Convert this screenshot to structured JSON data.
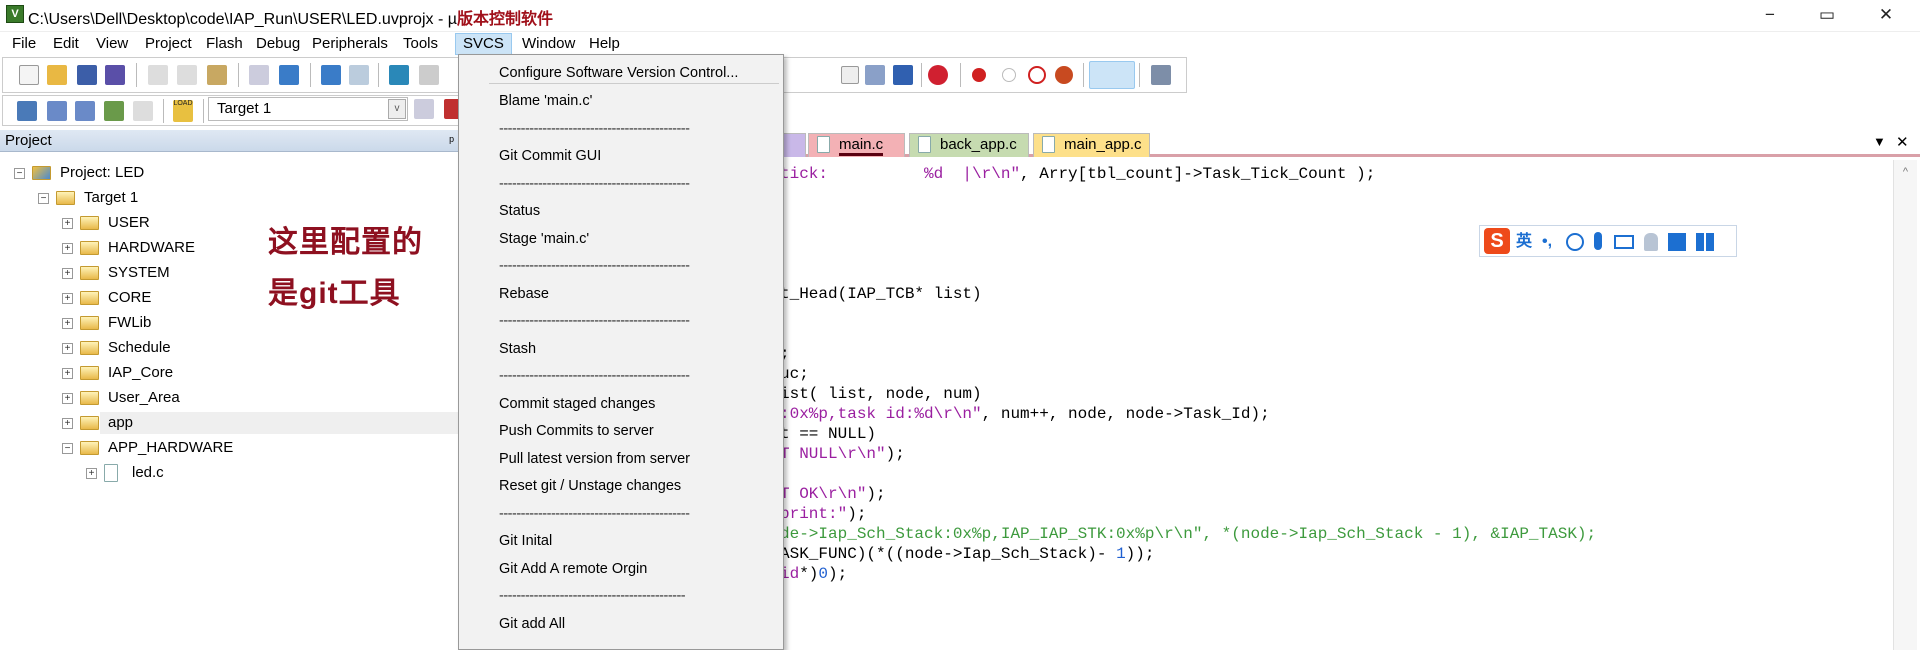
{
  "window": {
    "title": "C:\\Users\\Dell\\Desktop\\code\\IAP_Run\\USER\\LED.uvprojx - µ",
    "title_annotation": "版本控制软件",
    "controls": {
      "minimize": "−",
      "maximize": "▭",
      "close": "✕"
    }
  },
  "menubar": [
    "File",
    "Edit",
    "View",
    "Project",
    "Flash",
    "Debug",
    "Peripherals",
    "Tools",
    "SVCS",
    "Window",
    "Help"
  ],
  "toolbar": {
    "target": "Target 1",
    "load_label": "LOAD"
  },
  "project_panel": {
    "title": "Project",
    "pin": "ᵖ",
    "tree": [
      {
        "label": "Project: LED",
        "level": 0,
        "expanded": true,
        "kind": "project"
      },
      {
        "label": "Target 1",
        "level": 1,
        "expanded": true,
        "kind": "target"
      },
      {
        "label": "USER",
        "level": 2,
        "expanded": false,
        "kind": "folder"
      },
      {
        "label": "HARDWARE",
        "level": 2,
        "expanded": false,
        "kind": "folder"
      },
      {
        "label": "SYSTEM",
        "level": 2,
        "expanded": false,
        "kind": "folder"
      },
      {
        "label": "CORE",
        "level": 2,
        "expanded": false,
        "kind": "folder"
      },
      {
        "label": "FWLib",
        "level": 2,
        "expanded": false,
        "kind": "folder"
      },
      {
        "label": "Schedule",
        "level": 2,
        "expanded": false,
        "kind": "folder"
      },
      {
        "label": "IAP_Core",
        "level": 2,
        "expanded": false,
        "kind": "folder"
      },
      {
        "label": "User_Area",
        "level": 2,
        "expanded": false,
        "kind": "folder"
      },
      {
        "label": "app",
        "level": 2,
        "expanded": false,
        "kind": "folder",
        "selected": true
      },
      {
        "label": "APP_HARDWARE",
        "level": 2,
        "expanded": true,
        "kind": "folder"
      },
      {
        "label": "led.c",
        "level": 3,
        "expanded": false,
        "kind": "file"
      }
    ],
    "annotation": [
      "这里配置的",
      "是git工具"
    ]
  },
  "svcs_menu": [
    {
      "label": "Configure Software Version Control..."
    },
    {
      "separator": true
    },
    {
      "label": "Blame 'main.c'"
    },
    {
      "label": "--------------------------------------------",
      "dash": true
    },
    {
      "label": "Git Commit GUI"
    },
    {
      "label": "--------------------------------------------",
      "dash": true
    },
    {
      "label": "Status"
    },
    {
      "label": "Stage 'main.c'"
    },
    {
      "label": "--------------------------------------------",
      "dash": true
    },
    {
      "label": "Rebase"
    },
    {
      "label": "--------------------------------------------",
      "dash": true
    },
    {
      "label": "Stash"
    },
    {
      "label": "--------------------------------------------",
      "dash": true
    },
    {
      "label": "Commit staged changes"
    },
    {
      "label": "Push Commits to server"
    },
    {
      "label": "Pull latest version from server"
    },
    {
      "label": "Reset git / Unstage changes"
    },
    {
      "label": "--------------------------------------------",
      "dash": true
    },
    {
      "label": "Git Inital"
    },
    {
      "label": "Git Add A remote Orgin"
    },
    {
      "label": "-------------------------------------------",
      "dash": true
    },
    {
      "label": "Git add All"
    }
  ],
  "tabs": [
    {
      "label": "s",
      "color": "#c9b8e8"
    },
    {
      "label": "main.c",
      "color": "#f3b1b5",
      "active": true
    },
    {
      "label": "back_app.c",
      "color": "#c6dbb0"
    },
    {
      "label": "main_app.c",
      "color": "#fde08a"
    }
  ],
  "tab_controls": {
    "dropdown": "▼",
    "close": "✕"
  },
  "code_lines": [
    {
      "line": 0,
      "segs": [
        [
          "tick:          %d  |\\r\\n\"",
          "str"
        ],
        [
          ", Arry[tbl_count]->Task_Tick_Count );",
          "norm"
        ]
      ]
    },
    {
      "line": 6,
      "segs": [
        [
          "t_Head(IAP_TCB* list)",
          "norm"
        ]
      ]
    },
    {
      "line": 9,
      "segs": [
        [
          ";",
          "norm"
        ]
      ]
    },
    {
      "line": 10,
      "segs": [
        [
          "uc;",
          "norm"
        ]
      ]
    },
    {
      "line": 11,
      "segs": [
        [
          "ist( list, node, num)",
          "norm"
        ]
      ]
    },
    {
      "line": 12,
      "segs": [
        [
          ":0x%p,task id:%d\\r\\n\"",
          "str"
        ],
        [
          ", num++, node, node->Task_Id);",
          "norm"
        ]
      ]
    },
    {
      "line": 13,
      "segs": [
        [
          "t == NULL)",
          "norm"
        ]
      ]
    },
    {
      "line": 14,
      "segs": [
        [
          "T NULL\\r\\n\"",
          "str"
        ],
        [
          ");",
          "norm"
        ]
      ]
    },
    {
      "line": 16,
      "segs": [
        [
          "T OK\\r\\n\"",
          "str"
        ],
        [
          ");",
          "norm"
        ]
      ]
    },
    {
      "line": 17,
      "segs": [
        [
          "print:\"",
          "str"
        ],
        [
          ");",
          "norm"
        ]
      ]
    },
    {
      "line": 18,
      "segs": [
        [
          "de->Iap_Sch_Stack:0x%p,IAP_IAP_STK:0x%p\\r\\n\", *(node->Iap_Sch_Stack - 1), &IAP_TASK);",
          "green"
        ]
      ]
    },
    {
      "line": 19,
      "segs": [
        [
          "ASK_FUNC)(*((node->Iap_Sch_Stack)- ",
          "norm"
        ],
        [
          "1",
          "num"
        ],
        [
          "));",
          "norm"
        ]
      ]
    },
    {
      "line": 20,
      "segs": [
        [
          "id",
          "str"
        ],
        [
          "*)",
          "norm"
        ],
        [
          "0",
          "num"
        ],
        [
          ");",
          "norm"
        ]
      ]
    }
  ],
  "ime_bar": {
    "logo": "S",
    "mode": "英",
    "punct": "•,",
    "items": [
      "emoji-icon",
      "microphone-icon",
      "keyboard-icon",
      "user-icon",
      "skin-icon",
      "apps-icon"
    ]
  }
}
